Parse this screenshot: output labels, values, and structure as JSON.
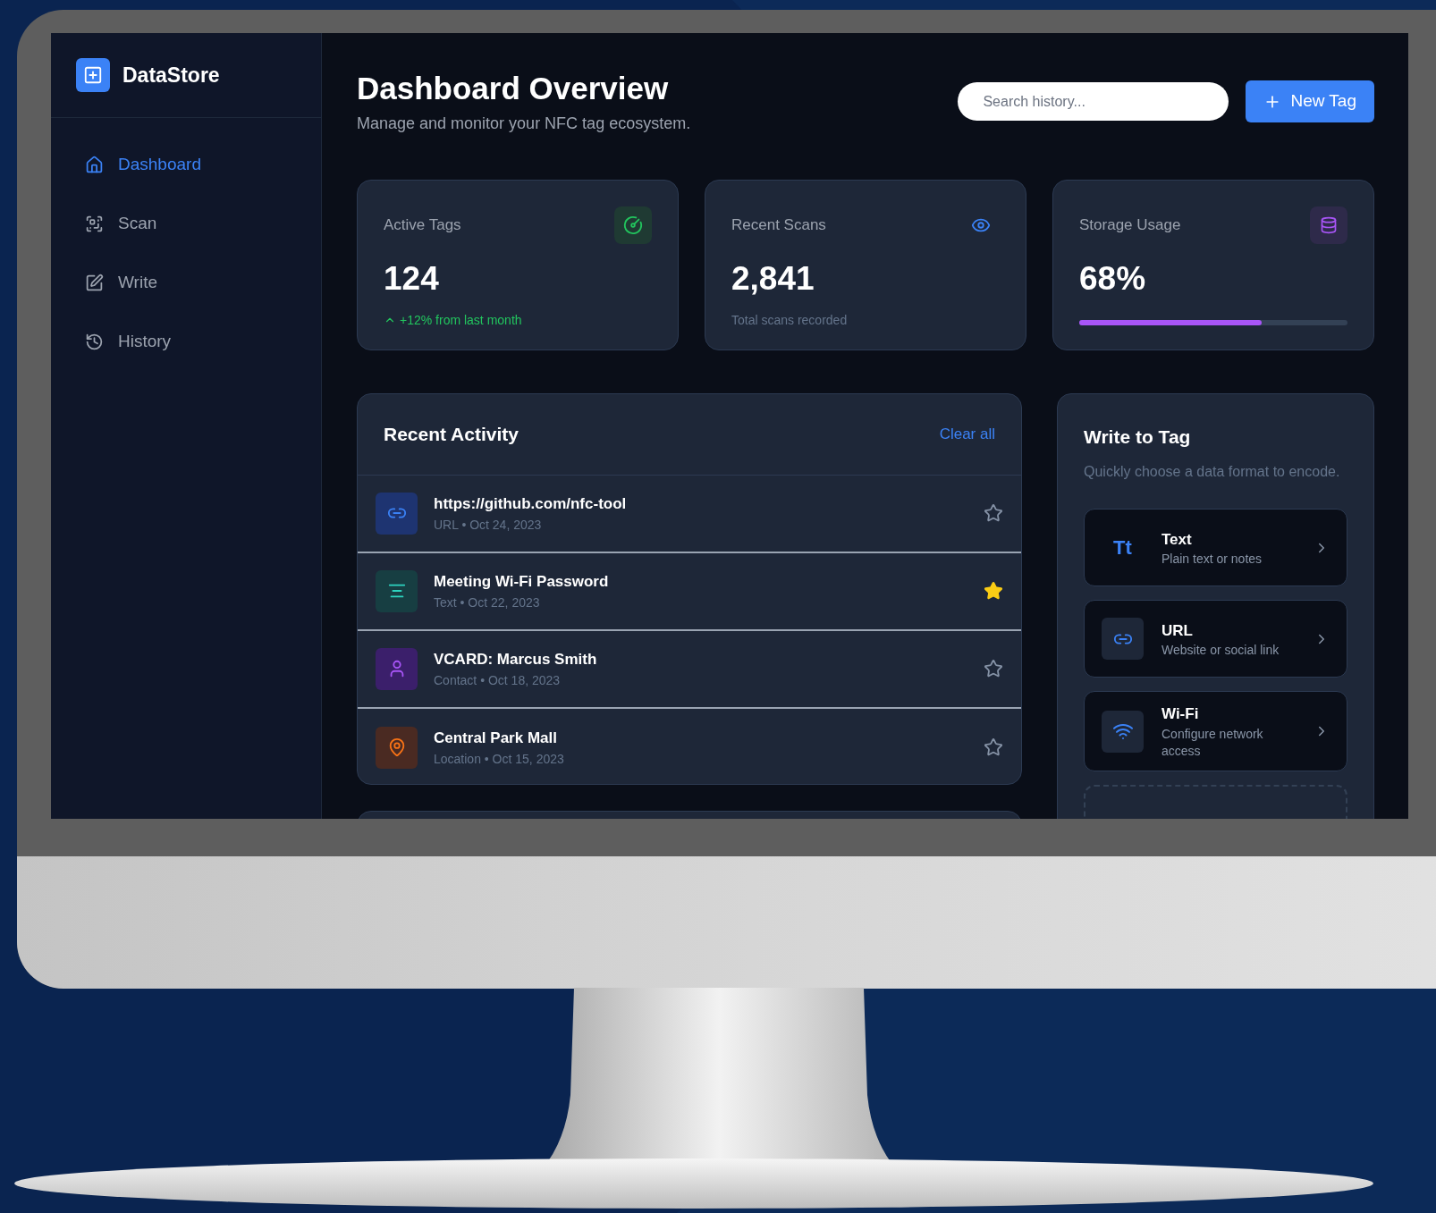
{
  "sidebar": {
    "brand": "DataStore",
    "items": [
      {
        "label": "Dashboard",
        "selected": true
      },
      {
        "label": "Scan",
        "selected": false
      },
      {
        "label": "Write",
        "selected": false
      },
      {
        "label": "History",
        "selected": false
      }
    ]
  },
  "header": {
    "title": "Dashboard Overview",
    "subtitle": "Manage and monitor your NFC tag ecosystem.",
    "search": {
      "placeholder": "Search history..."
    },
    "button": "New Tag"
  },
  "stats": [
    {
      "kind": "trend",
      "label": "Active Tags",
      "value": "124",
      "detail": "+12% from last month"
    },
    {
      "kind": "note",
      "label": "Recent Scans",
      "value": "2,841",
      "detail": "Total scans recorded"
    },
    {
      "kind": "meter",
      "label": "Storage Usage",
      "value": "68%",
      "level": 0.68
    }
  ],
  "recent_activity": {
    "title": "Recent Activity",
    "action": "Clear all",
    "items": [
      {
        "kind": "url",
        "title": "https://github.com/nfc-tool",
        "meta": "URL • Oct 24, 2023",
        "starred": false
      },
      {
        "kind": "text",
        "title": "Meeting Wi-Fi Password",
        "meta": "Text • Oct 22, 2023",
        "starred": true
      },
      {
        "kind": "contact",
        "title": "VCARD: Marcus Smith",
        "meta": "Contact • Oct 18, 2023",
        "starred": false
      },
      {
        "kind": "location",
        "title": "Central Park Mall",
        "meta": "Location • Oct 15, 2023",
        "starred": false
      }
    ]
  },
  "write_to_tag": {
    "title": "Write to Tag",
    "description": "Quickly choose a data format to encode.",
    "formats": [
      {
        "kind": "text",
        "icon_text": "Tt",
        "title": "Text",
        "description": "Plain text or notes"
      },
      {
        "kind": "url",
        "title": "URL",
        "description": "Website or social link"
      },
      {
        "kind": "wifi",
        "title": "Wi-Fi",
        "description": "Configure network access"
      }
    ]
  }
}
